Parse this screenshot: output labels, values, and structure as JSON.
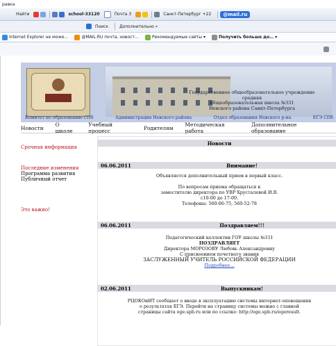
{
  "browser": {
    "top_text": "равка",
    "search_button": "Найти",
    "favorite_tab": "school-33120",
    "mail_tab": "Почта 3",
    "weather": "Санкт-Петербург",
    "weather_temp": "+22",
    "mail_brand": "@mail.ru",
    "search_placeholder": "Поиск",
    "extra_label": "Дополнительно »",
    "fav_items": [
      "Internet Explorer не може…",
      "@MAIL.RU почта, новост…",
      "Рекомендуемые сайты ▾",
      "Получить больше до… ▾"
    ]
  },
  "site": {
    "school_name": [
      "Государственное общеобразовательное учреждение средняя",
      "общеобразовательная школа №331",
      "Невского района Санкт-Петербурга"
    ],
    "links": [
      "Комитет по образованию СПб",
      "Администрация Невского района",
      "Отдел образования Невского р-на",
      "ЕГЭ СПб"
    ],
    "nav": [
      "Новости",
      "О школе",
      "Учебный процесс",
      "Родителям",
      "Методическая работа",
      "Дополнительное образование"
    ],
    "sidebar": {
      "urgent": "Срочная информация",
      "recent": "Последние изменения",
      "program": "Программа развития",
      "report": "Публичный отчет",
      "important": "Это важно!"
    },
    "news_title": "Новости",
    "news": [
      {
        "date": "06.06.2011",
        "title": "Внимание!",
        "lines": [
          "Объявляется дополнительный прием в первый класс.",
          "",
          "По вопросам приема обращаться к",
          "заместителю директора по УВР Хрусталевой И.В.",
          "с10-00 до 17-00.",
          "Телефоны: 560-06-75, 560-52-78"
        ]
      },
      {
        "date": "06.06.2011",
        "title": "Поздравляем!!!",
        "lines": [
          "Педагогический коллектив ГОУ школы №331",
          "ПОЗДРАВЛЯЕТ",
          "Директора МОРОЗОВУ Любовь Александровну",
          "С присвоением почетного звания",
          "ЗАСЛУЖЕННЫЙ УЧИТЕЛЬ РОССИЙСКОЙ ФЕДЕРАЦИИ"
        ],
        "link": "Подробнее…"
      },
      {
        "date": "02.06.2011",
        "title": "Выпускникам!",
        "lines": [
          "РЦОКОиИТ сообщает о вводе в эксплуатацию системы интернет-оповещения",
          "о результатах ЕГЭ. Перейти на страницу системы можно с главной",
          "страницы сайта ege.spb.ru или по ссылке: http://ege.spb.ru/egeresult."
        ]
      }
    ]
  },
  "colors": {
    "red": "#b4131a",
    "link": "#1f47b7",
    "header": "#dadbe1"
  }
}
